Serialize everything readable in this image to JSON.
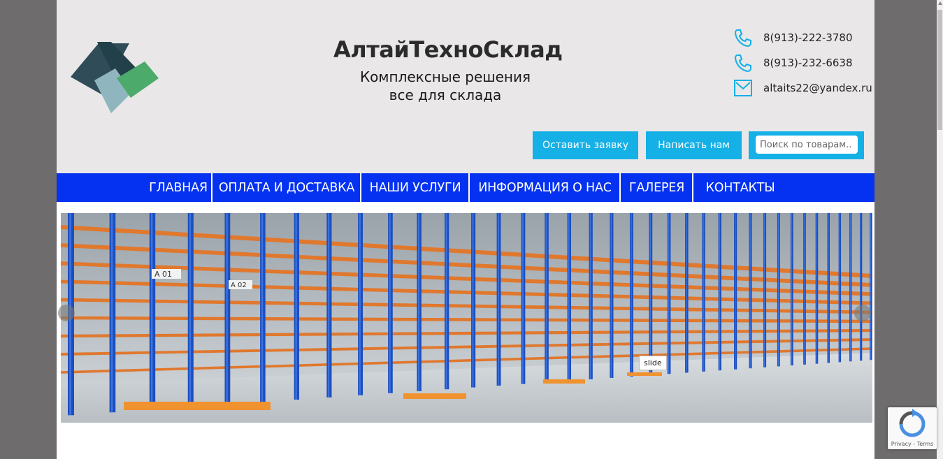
{
  "site": {
    "title": "АлтайТехноСклад",
    "tagline_line1": "Комплексные решения",
    "tagline_line2": "все для склада"
  },
  "contacts": [
    {
      "icon": "phone-icon",
      "text": "8(913)-222-3780"
    },
    {
      "icon": "phone-icon",
      "text": "8(913)-232-6638"
    },
    {
      "icon": "mail-icon",
      "text": "altaits22@yandex.ru"
    }
  ],
  "buttons": {
    "request": "Оставить заявку",
    "write": "Написать нам"
  },
  "search": {
    "placeholder": "Поиск по товарам.."
  },
  "nav": [
    {
      "label": "ГЛАВНАЯ"
    },
    {
      "label": "ОПЛАТА И ДОСТАВКА"
    },
    {
      "label": "НАШИ УСЛУГИ"
    },
    {
      "label": "ИНФОРМАЦИЯ О НАС"
    },
    {
      "label": "ГАЛЕРЕЯ"
    },
    {
      "label": "КОНТАКТЫ"
    }
  ],
  "slider": {
    "tooltip": "slide",
    "shelf_labels": [
      "A 01",
      "A 02"
    ]
  },
  "recaptcha": {
    "text": "Privacy - Terms"
  },
  "colors": {
    "accent": "#14b0e6",
    "nav": "#0532f0",
    "header_bg": "#e9e7e8"
  }
}
